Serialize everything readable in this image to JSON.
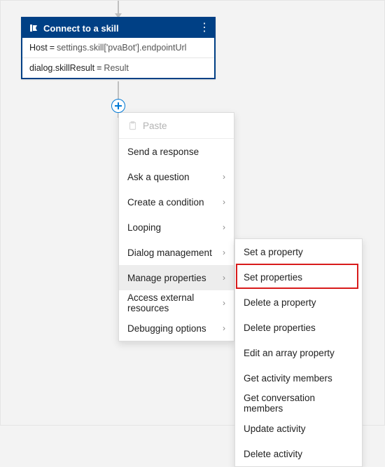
{
  "node": {
    "title": "Connect to a skill",
    "row1_key": "Host",
    "row1_eq": "=",
    "row1_val": "settings.skill['pvaBot'].endpointUrl",
    "row2_key": "dialog.skillResult",
    "row2_eq": "=",
    "row2_val": "Result"
  },
  "menu": {
    "paste": "Paste",
    "items": [
      {
        "label": "Send a response",
        "sub": false
      },
      {
        "label": "Ask a question",
        "sub": true
      },
      {
        "label": "Create a condition",
        "sub": true
      },
      {
        "label": "Looping",
        "sub": true
      },
      {
        "label": "Dialog management",
        "sub": true
      },
      {
        "label": "Manage properties",
        "sub": true,
        "active": true
      },
      {
        "label": "Access external resources",
        "sub": true
      },
      {
        "label": "Debugging options",
        "sub": true
      }
    ]
  },
  "submenu": {
    "items": [
      "Set a property",
      "Set properties",
      "Delete a property",
      "Delete properties",
      "Edit an array property",
      "Get activity members",
      "Get conversation members",
      "Update activity",
      "Delete activity"
    ]
  }
}
